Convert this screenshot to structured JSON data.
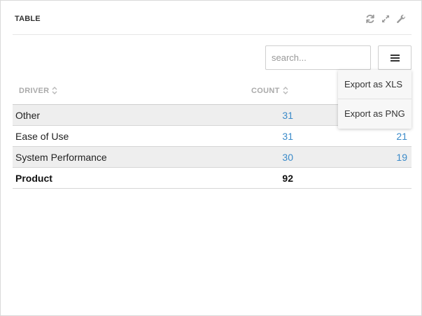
{
  "header": {
    "title": "TABLE",
    "icons": [
      "refresh-icon",
      "expand-icon",
      "wrench-icon"
    ]
  },
  "toolbar": {
    "search_placeholder": "search...",
    "search_value": "",
    "menu_icon": "hamburger-icon"
  },
  "dropdown": {
    "items": [
      {
        "label": "Export as XLS"
      },
      {
        "label": "Export as PNG"
      }
    ]
  },
  "table": {
    "columns": [
      {
        "label": "DRIVER"
      },
      {
        "label": "COUNT"
      }
    ],
    "rows": [
      {
        "driver": "Other",
        "count": "31",
        "extra": ""
      },
      {
        "driver": "Ease of Use",
        "count": "31",
        "extra": "21"
      },
      {
        "driver": "System Performance",
        "count": "30",
        "extra": "19"
      }
    ],
    "total": {
      "driver": "Product",
      "count": "92"
    }
  },
  "colors": {
    "link_blue": "#3a8ac9",
    "shaded_row": "#eeeeee",
    "header_text": "#aaaaaa"
  }
}
